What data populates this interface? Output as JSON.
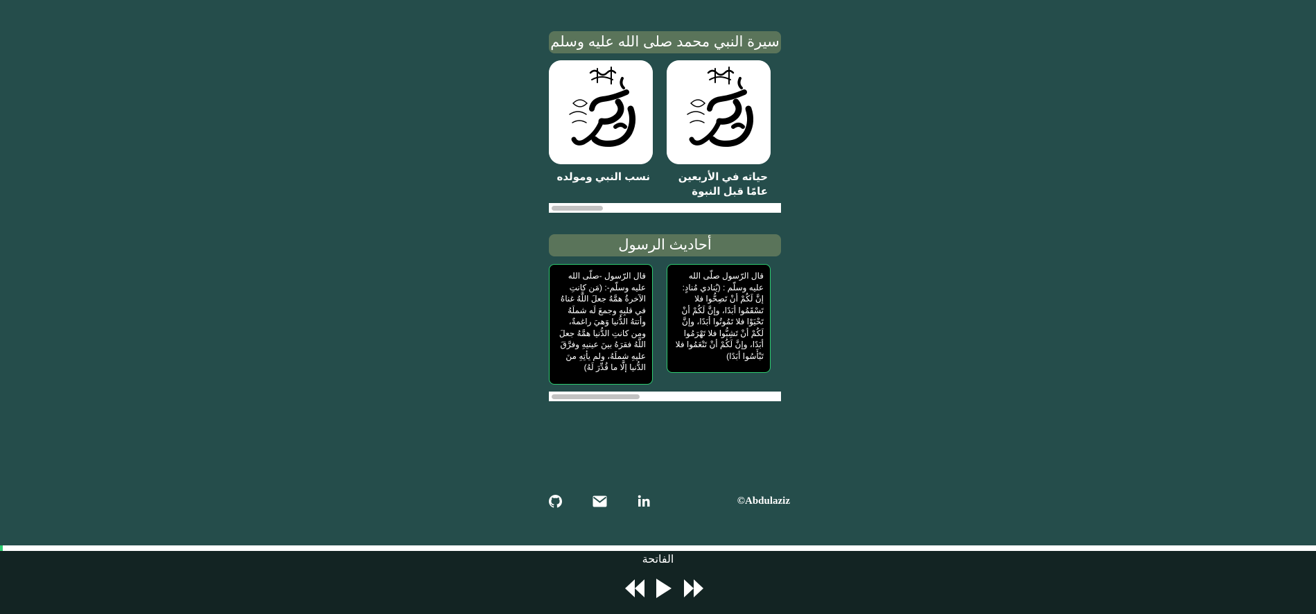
{
  "sira": {
    "title": "سيرة النبي محمد صلى الله عليه وسلم",
    "cards": [
      {
        "caption": "حياته في الأربعين عامًا قبل النبوة",
        "image": "muhammad-calligraphy-image"
      },
      {
        "caption": "نسب النبي ومولده",
        "image": "muhammad-calligraphy-image"
      }
    ],
    "scroll_fraction": 0.22
  },
  "hadith": {
    "title": "أحاديث الرسول",
    "cards": [
      {
        "text": "قال الرّسول صلّى الله عليه وسلّم : (يُنادي مُنادٍ: إنَّ لَكُمْ أنْ تَصِحُّوا فلا تَسْقَمُوا أبَدًا، وإنَّ لَكُمْ أنْ تَحْيَوْا فلا تَمُوتُوا أبَدًا، وإنَّ لَكُمْ أنْ تَشِبُّوا فلا تَهْرَمُوا أبَدًا، وإنَّ لَكُمْ أنْ تَنْعَمُوا فلا تَبْأَسُوا أبَدًا)"
      },
      {
        "text": "قال الرّسول -صلّى الله عليه وسلّم-: (مَن كانتِ الآخرةُ همَّهُ جعلَ اللَّهُ غناهُ في قلبِهِ وجمعَ لَه شملَهُ وأتتهُ الدُّنيا وَهيَ راغمةٌ، ومن كانتِ الدُّنيا همَّهُ جعلَ اللَّهُ فقرَهُ بينَ عينيهِ وفرَّقَ عليهِ شملَهُ، ولم يأتِهِ منَ الدُّنيا إلَّا ما قُدِّرَ لَهُ)"
      }
    ],
    "scroll_fraction": 0.38
  },
  "footer": {
    "icons": [
      "github-icon",
      "envelope-icon",
      "linkedin-icon"
    ],
    "copyright": "©Abdulaziz"
  },
  "player": {
    "track": "الفاتحة",
    "progress": 0.002,
    "accent": "#2ecc71",
    "controls": [
      "rewind-icon",
      "play-icon",
      "fast-forward-icon"
    ]
  },
  "colors": {
    "background": "#254d4b",
    "section_title_bg": "#5a745a",
    "player_bg": "#132423",
    "card_border": "#2ecc71"
  }
}
